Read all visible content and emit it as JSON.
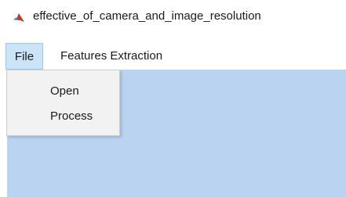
{
  "window": {
    "title": "effective_of_camera_and_image_resolution",
    "icon": "matlab-icon"
  },
  "menubar": {
    "items": [
      {
        "label": "File",
        "active": true
      },
      {
        "label": "Features Extraction",
        "active": false
      }
    ]
  },
  "file_menu": {
    "items": [
      {
        "label": "Open"
      },
      {
        "label": "Process"
      }
    ]
  },
  "colors": {
    "canvas_background": "#b9d3f0",
    "menu_highlight": "#cce4f7",
    "dropdown_background": "#f2f2f2"
  }
}
